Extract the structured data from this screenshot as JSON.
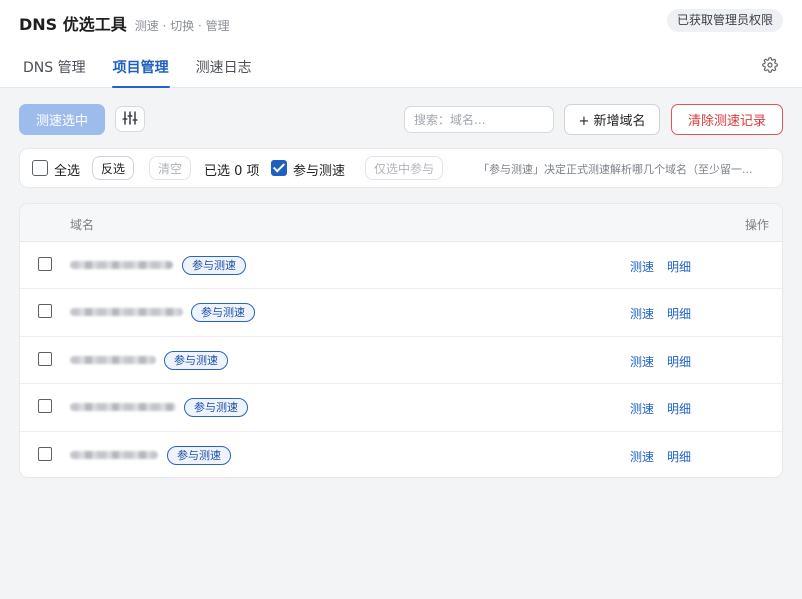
{
  "header": {
    "title": "DNS 优选工具",
    "subtitle": "测速 · 切换 · 管理",
    "admin_badge": "已获取管理员权限",
    "tabs": [
      {
        "label": "DNS 管理",
        "active": false
      },
      {
        "label": "项目管理",
        "active": true
      },
      {
        "label": "测速日志",
        "active": false
      }
    ],
    "settings_icon": "gear-icon"
  },
  "toolbar": {
    "speedtest_selected_label": "测速选中",
    "filter_icon": "sliders-icon",
    "search_placeholder": "搜索：域名...",
    "add_domain_label": "+ 新增域名",
    "clear_records_label": "清除测速记录"
  },
  "selection_bar": {
    "select_all_label": "全选",
    "invert_label": "反选",
    "clear_label": "清空",
    "selected_count_text": "已选 0 项",
    "participate_label": "参与测速",
    "participate_checked": true,
    "only_selected_label": "仅选中参与",
    "hint_text": "「参与测速」决定正式测速解析哪几个域名（至少留一..."
  },
  "table": {
    "columns": {
      "name": "域名",
      "actions": "操作"
    },
    "rows": [
      {
        "domain_blurred": true,
        "tag": "参与测速",
        "action_test": "测速",
        "action_detail": "明细"
      },
      {
        "domain_blurred": true,
        "tag": "参与测速",
        "action_test": "测速",
        "action_detail": "明细"
      },
      {
        "domain_blurred": true,
        "tag": "参与测速",
        "action_test": "测速",
        "action_detail": "明细"
      },
      {
        "domain_blurred": true,
        "tag": "参与测速",
        "action_test": "测速",
        "action_detail": "明细"
      },
      {
        "domain_blurred": true,
        "tag": "参与测速",
        "action_test": "测速",
        "action_detail": "明细"
      }
    ]
  },
  "colors": {
    "accent": "#1f5fbf",
    "primary_button": "#9dbcec",
    "danger": "#d33b3b",
    "background": "#f3f4f6"
  }
}
